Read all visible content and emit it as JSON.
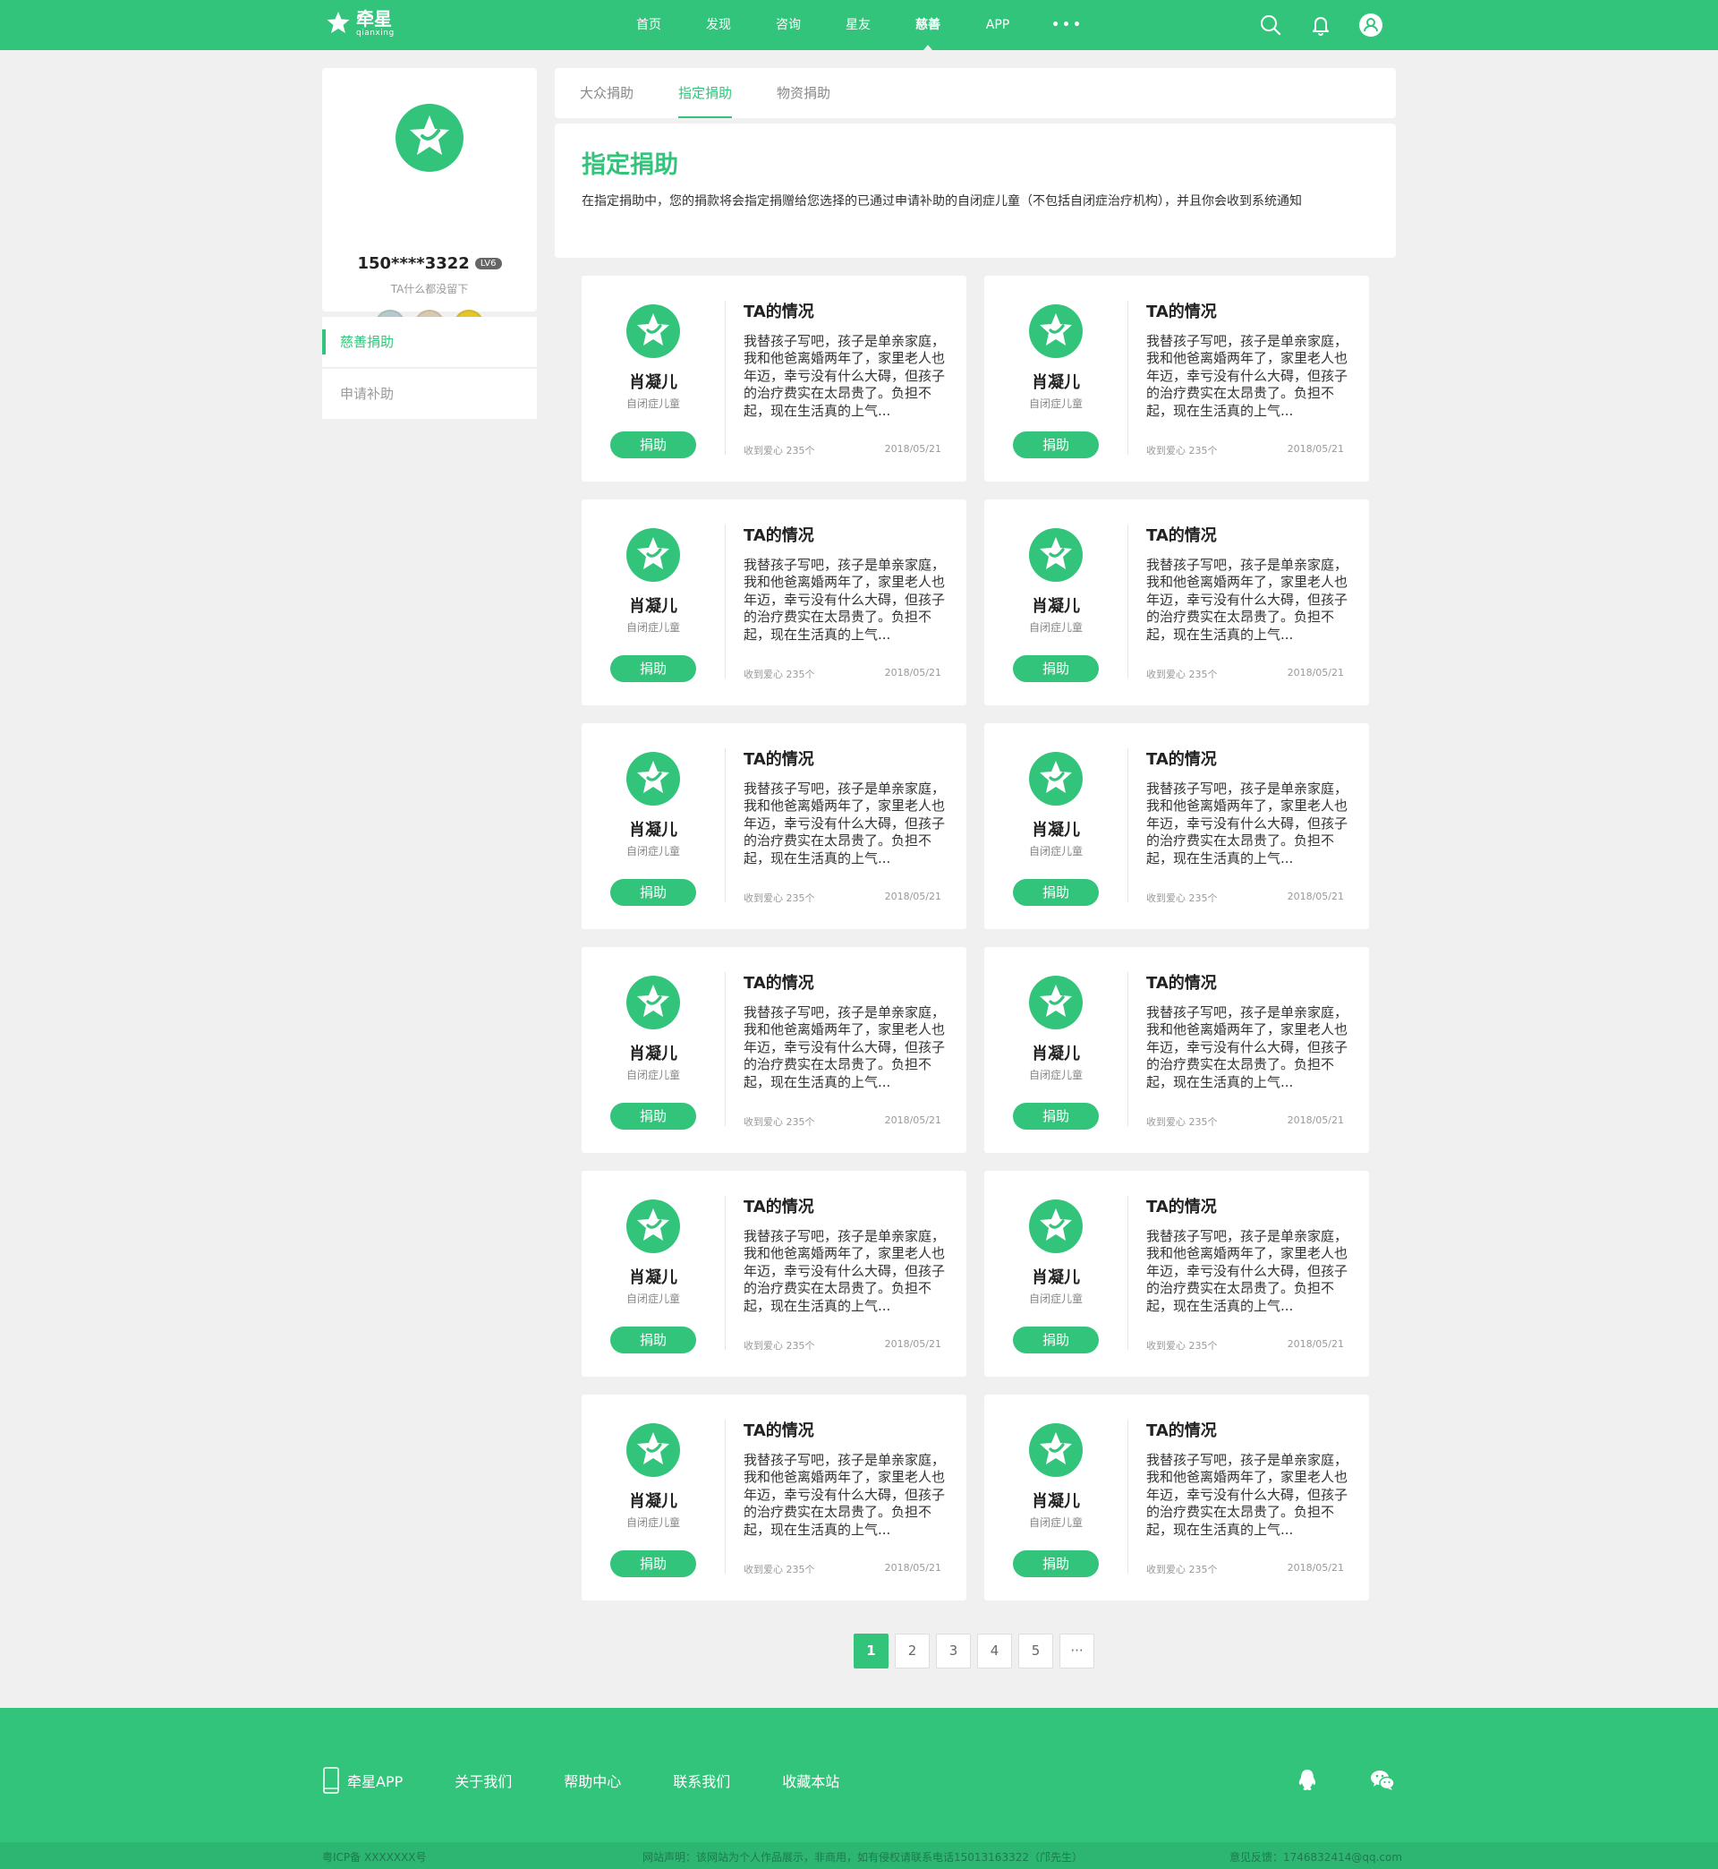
{
  "header": {
    "logo_cn": "牵星",
    "logo_en": "qianxing",
    "nav": [
      "首页",
      "发现",
      "咨询",
      "星友",
      "慈善",
      "APP"
    ],
    "nav_more": "•••",
    "active_nav": "慈善"
  },
  "profile": {
    "name": "150****3322",
    "level": "LV6",
    "sign": "TA什么都没留下",
    "badges": [
      "question-badge",
      "pencil-badge",
      "heart-badge"
    ]
  },
  "side_menu": [
    {
      "label": "慈善捐助",
      "active": true
    },
    {
      "label": "申请补助",
      "active": false
    }
  ],
  "tabs": [
    {
      "label": "大众捐助",
      "active": false
    },
    {
      "label": "指定捐助",
      "active": true
    },
    {
      "label": "物资捐助",
      "active": false
    }
  ],
  "intro": {
    "title": "指定捐助",
    "text": "在指定捐助中，您的捐款将会指定捐赠给您选择的已通过申请补助的自闭症儿童（不包括自闭症治疗机构），并且你会收到系统通知"
  },
  "cards": [
    {
      "name": "肖凝儿",
      "desc": "自闭症儿童",
      "button": "捐助",
      "story_title": "TA的情况",
      "story": "我替孩子写吧，孩子是单亲家庭，我和他爸离婚两年了，家里老人也年迈，幸亏没有什么大碍，但孩子的治疗费实在太昂贵了。负担不起，现在生活真的上气...",
      "loves": "收到爱心 235个",
      "date": "2018/05/21"
    },
    {
      "name": "肖凝儿",
      "desc": "自闭症儿童",
      "button": "捐助",
      "story_title": "TA的情况",
      "story": "我替孩子写吧，孩子是单亲家庭，我和他爸离婚两年了，家里老人也年迈，幸亏没有什么大碍，但孩子的治疗费实在太昂贵了。负担不起，现在生活真的上气...",
      "loves": "收到爱心 235个",
      "date": "2018/05/21"
    },
    {
      "name": "肖凝儿",
      "desc": "自闭症儿童",
      "button": "捐助",
      "story_title": "TA的情况",
      "story": "我替孩子写吧，孩子是单亲家庭，我和他爸离婚两年了，家里老人也年迈，幸亏没有什么大碍，但孩子的治疗费实在太昂贵了。负担不起，现在生活真的上气...",
      "loves": "收到爱心 235个",
      "date": "2018/05/21"
    },
    {
      "name": "肖凝儿",
      "desc": "自闭症儿童",
      "button": "捐助",
      "story_title": "TA的情况",
      "story": "我替孩子写吧，孩子是单亲家庭，我和他爸离婚两年了，家里老人也年迈，幸亏没有什么大碍，但孩子的治疗费实在太昂贵了。负担不起，现在生活真的上气...",
      "loves": "收到爱心 235个",
      "date": "2018/05/21"
    },
    {
      "name": "肖凝儿",
      "desc": "自闭症儿童",
      "button": "捐助",
      "story_title": "TA的情况",
      "story": "我替孩子写吧，孩子是单亲家庭，我和他爸离婚两年了，家里老人也年迈，幸亏没有什么大碍，但孩子的治疗费实在太昂贵了。负担不起，现在生活真的上气...",
      "loves": "收到爱心 235个",
      "date": "2018/05/21"
    },
    {
      "name": "肖凝儿",
      "desc": "自闭症儿童",
      "button": "捐助",
      "story_title": "TA的情况",
      "story": "我替孩子写吧，孩子是单亲家庭，我和他爸离婚两年了，家里老人也年迈，幸亏没有什么大碍，但孩子的治疗费实在太昂贵了。负担不起，现在生活真的上气...",
      "loves": "收到爱心 235个",
      "date": "2018/05/21"
    },
    {
      "name": "肖凝儿",
      "desc": "自闭症儿童",
      "button": "捐助",
      "story_title": "TA的情况",
      "story": "我替孩子写吧，孩子是单亲家庭，我和他爸离婚两年了，家里老人也年迈，幸亏没有什么大碍，但孩子的治疗费实在太昂贵了。负担不起，现在生活真的上气...",
      "loves": "收到爱心 235个",
      "date": "2018/05/21"
    },
    {
      "name": "肖凝儿",
      "desc": "自闭症儿童",
      "button": "捐助",
      "story_title": "TA的情况",
      "story": "我替孩子写吧，孩子是单亲家庭，我和他爸离婚两年了，家里老人也年迈，幸亏没有什么大碍，但孩子的治疗费实在太昂贵了。负担不起，现在生活真的上气...",
      "loves": "收到爱心 235个",
      "date": "2018/05/21"
    },
    {
      "name": "肖凝儿",
      "desc": "自闭症儿童",
      "button": "捐助",
      "story_title": "TA的情况",
      "story": "我替孩子写吧，孩子是单亲家庭，我和他爸离婚两年了，家里老人也年迈，幸亏没有什么大碍，但孩子的治疗费实在太昂贵了。负担不起，现在生活真的上气...",
      "loves": "收到爱心 235个",
      "date": "2018/05/21"
    },
    {
      "name": "肖凝儿",
      "desc": "自闭症儿童",
      "button": "捐助",
      "story_title": "TA的情况",
      "story": "我替孩子写吧，孩子是单亲家庭，我和他爸离婚两年了，家里老人也年迈，幸亏没有什么大碍，但孩子的治疗费实在太昂贵了。负担不起，现在生活真的上气...",
      "loves": "收到爱心 235个",
      "date": "2018/05/21"
    },
    {
      "name": "肖凝儿",
      "desc": "自闭症儿童",
      "button": "捐助",
      "story_title": "TA的情况",
      "story": "我替孩子写吧，孩子是单亲家庭，我和他爸离婚两年了，家里老人也年迈，幸亏没有什么大碍，但孩子的治疗费实在太昂贵了。负担不起，现在生活真的上气...",
      "loves": "收到爱心 235个",
      "date": "2018/05/21"
    },
    {
      "name": "肖凝儿",
      "desc": "自闭症儿童",
      "button": "捐助",
      "story_title": "TA的情况",
      "story": "我替孩子写吧，孩子是单亲家庭，我和他爸离婚两年了，家里老人也年迈，幸亏没有什么大碍，但孩子的治疗费实在太昂贵了。负担不起，现在生活真的上气...",
      "loves": "收到爱心 235个",
      "date": "2018/05/21"
    }
  ],
  "pagination": [
    "1",
    "2",
    "3",
    "4",
    "5",
    "···"
  ],
  "active_page": "1",
  "footer": {
    "links": [
      "牵星APP",
      "关于我们",
      "帮助中心",
      "联系我们",
      "收藏本站"
    ],
    "icp": "粤ICP备 XXXXXXX号",
    "statement": "网站声明：该网站为个人作品展示，非商用，如有侵权请联系电话15013163322（邝先生）",
    "feedback": "意见反馈：1746832414@qq.com"
  },
  "colors": {
    "brand_green": "#33c47b",
    "footer_bottom": "#2db572",
    "background": "#f0f0f0"
  }
}
